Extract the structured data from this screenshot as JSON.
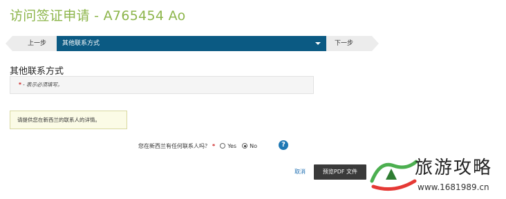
{
  "app_title": "访问签证申请 - A765454 Ao",
  "nav": {
    "prev_label": "上一步",
    "current_step": "其他联系方式",
    "next_label": "下一步"
  },
  "section_title": "其他联系方式",
  "required_note": {
    "star": "*",
    "text": "- 表示必须填写。"
  },
  "info_text": "请提供您在新西兰的联系人的详情。",
  "question": {
    "text": "您在新西兰有任何联系人吗？",
    "required_mark": "*",
    "options": [
      {
        "label": "Yes",
        "selected": false
      },
      {
        "label": "No",
        "selected": true
      }
    ]
  },
  "help_icon": "?",
  "actions": {
    "cancel_label": "取消",
    "preview_label": "预览PDF 文件"
  },
  "watermark": {
    "text": "旅游攻略",
    "url": "www.1681989.cn"
  },
  "colors": {
    "title_green": "#8cb54a",
    "nav_blue": "#0b5a83",
    "help_blue": "#1f78b4",
    "required_red": "#cc2222"
  }
}
